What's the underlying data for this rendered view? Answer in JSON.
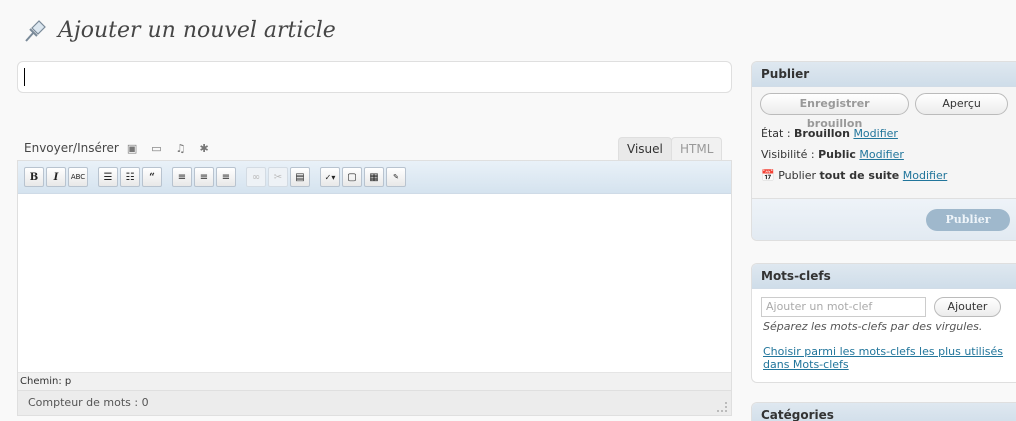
{
  "header": {
    "title": "Ajouter un nouvel article",
    "icon": "pushpin-icon"
  },
  "title_field": {
    "value": ""
  },
  "media": {
    "label": "Envoyer/Insérer",
    "icons": [
      "image-icon",
      "video-icon",
      "audio-icon",
      "media-icon"
    ]
  },
  "tabs": {
    "visual": "Visuel",
    "html": "HTML"
  },
  "toolbar": {
    "buttons": [
      "bold",
      "italic",
      "strikethrough",
      "bullet-list",
      "numbered-list",
      "blockquote",
      "align-left",
      "align-center",
      "align-right",
      "link",
      "unlink",
      "more",
      "spellcheck",
      "fullscreen",
      "kitchen-sink",
      "cforms"
    ]
  },
  "editor": {
    "path": "Chemin: p",
    "word_count": "Compteur de mots : 0"
  },
  "publish": {
    "title": "Publier",
    "save_draft": "Enregistrer brouillon",
    "preview": "Aperçu",
    "status_label": "État :",
    "status_value": "Brouillon",
    "visibility_label": "Visibilité :",
    "visibility_value": "Public",
    "schedule_label": "Publier",
    "schedule_value": "tout de suite",
    "edit_link": "Modifier",
    "publish_button": "Publier"
  },
  "tags": {
    "title": "Mots-clefs",
    "placeholder": "Ajouter un mot-clef",
    "add_button": "Ajouter",
    "hint": "Séparez les mots-clefs par des virgules.",
    "choose_link": "Choisir parmi les mots-clefs les plus utilisés dans Mots-clefs"
  },
  "categories": {
    "title": "Catégories"
  },
  "colors": {
    "link": "#21759b",
    "box_header": "#d5e3ef",
    "publish_button": "#9fb8cc"
  }
}
